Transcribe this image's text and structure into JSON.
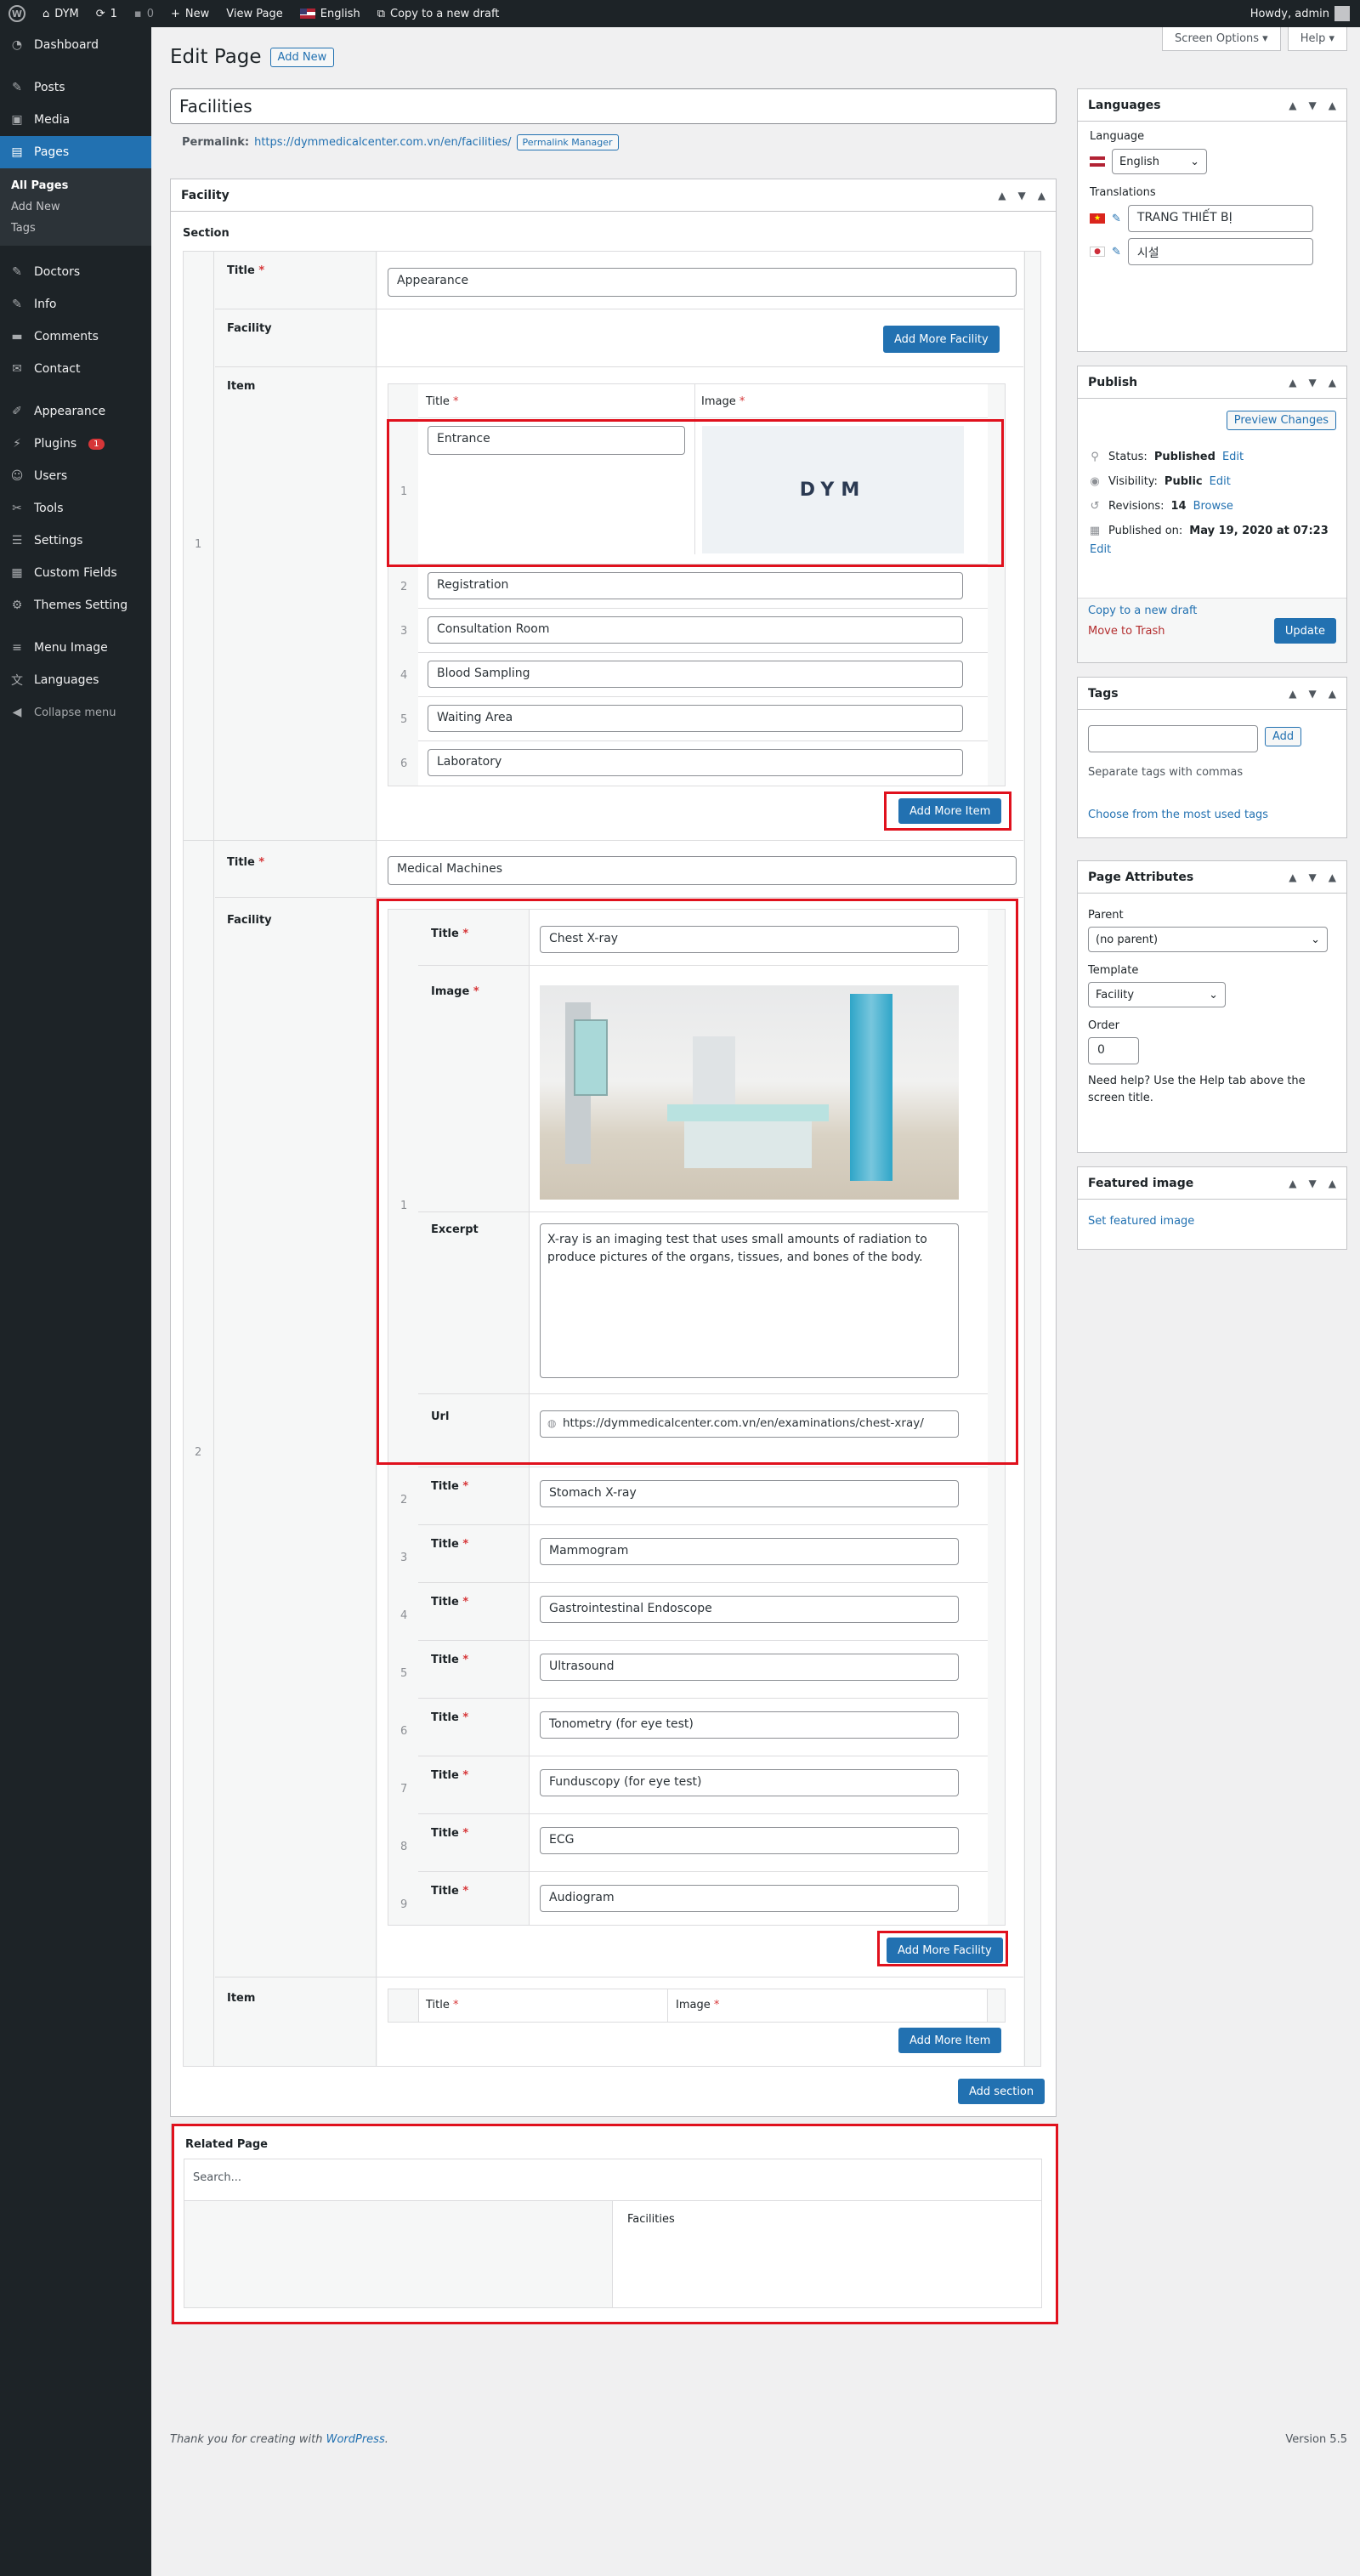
{
  "adminbar": {
    "site_name": "DYM",
    "updates_count": "1",
    "comments_count": "0",
    "new_label": "New",
    "view_page_label": "View Page",
    "language_label": "English",
    "copy_draft_label": "Copy to a new draft",
    "howdy": "Howdy, admin"
  },
  "sidebar": {
    "items": [
      {
        "label": "Dashboard",
        "icon": "dashboard-icon"
      },
      {
        "label": "Posts",
        "icon": "pin-icon"
      },
      {
        "label": "Media",
        "icon": "media-icon"
      },
      {
        "label": "Pages",
        "icon": "pages-icon"
      },
      {
        "label": "Doctors",
        "icon": "admin-post-icon"
      },
      {
        "label": "Info",
        "icon": "admin-post-icon"
      },
      {
        "label": "Comments",
        "icon": "comment-icon"
      },
      {
        "label": "Contact",
        "icon": "email-icon"
      },
      {
        "label": "Appearance",
        "icon": "brush-icon"
      },
      {
        "label": "Plugins",
        "icon": "plugin-icon",
        "badge": "1"
      },
      {
        "label": "Users",
        "icon": "users-icon"
      },
      {
        "label": "Tools",
        "icon": "wrench-icon"
      },
      {
        "label": "Settings",
        "icon": "settings-icon"
      },
      {
        "label": "Custom Fields",
        "icon": "grid-icon"
      },
      {
        "label": "Themes Setting",
        "icon": "gear-icon"
      },
      {
        "label": "Menu Image",
        "icon": "menu-icon"
      },
      {
        "label": "Languages",
        "icon": "translation-icon"
      }
    ],
    "submenu": [
      "All Pages",
      "Add New",
      "Tags"
    ],
    "collapse_label": "Collapse menu"
  },
  "screen_options": "Screen Options ▾",
  "help": "Help ▾",
  "page": {
    "heading": "Edit Page",
    "add_new": "Add New",
    "title_value": "Facilities",
    "permalink_label": "Permalink:",
    "permalink_url": "https://dymmedicalcenter.com.vn/en/facilities/",
    "permalink_manager": "Permalink Manager"
  },
  "facility": {
    "box_title": "Facility",
    "section_label": "Section",
    "title_label": "Title",
    "facility_label": "Facility",
    "item_label": "Item",
    "image_label": "Image",
    "excerpt_label": "Excerpt",
    "url_label": "Url",
    "add_more_facility": "Add More Facility",
    "add_more_item": "Add More Item",
    "add_section": "Add section",
    "section1": {
      "index": "1",
      "title": "Appearance",
      "items": [
        {
          "n": "1",
          "title": "Entrance",
          "image_text": "DYM"
        },
        {
          "n": "2",
          "title": "Registration"
        },
        {
          "n": "3",
          "title": "Consultation Room"
        },
        {
          "n": "4",
          "title": "Blood Sampling"
        },
        {
          "n": "5",
          "title": "Waiting Area"
        },
        {
          "n": "6",
          "title": "Laboratory"
        }
      ]
    },
    "section2": {
      "index": "2",
      "title": "Medical Machines",
      "first": {
        "n": "1",
        "title": "Chest X-ray",
        "excerpt": "X-ray is an imaging test that uses small amounts of radiation to produce pictures of the organs, tissues, and bones of the body.",
        "url": "https://dymmedicalcenter.com.vn/en/examinations/chest-xray/"
      },
      "facilities": [
        {
          "n": "2",
          "title": "Stomach X-ray"
        },
        {
          "n": "3",
          "title": "Mammogram"
        },
        {
          "n": "4",
          "title": "Gastrointestinal Endoscope"
        },
        {
          "n": "5",
          "title": "Ultrasound"
        },
        {
          "n": "6",
          "title": "Tonometry (for eye test)"
        },
        {
          "n": "7",
          "title": "Funduscopy (for eye test)"
        },
        {
          "n": "8",
          "title": "ECG"
        },
        {
          "n": "9",
          "title": "Audiogram"
        }
      ]
    }
  },
  "related": {
    "title": "Related Page",
    "search_placeholder": "Search...",
    "selected": "Facilities"
  },
  "languages_box": {
    "title": "Languages",
    "language_label": "Language",
    "language_value": "English",
    "translations_label": "Translations",
    "vi_value": "TRANG THIẾT BỊ",
    "ko_value": "시설"
  },
  "publish": {
    "title": "Publish",
    "preview": "Preview Changes",
    "status_label": "Status:",
    "status_value": "Published",
    "visibility_label": "Visibility:",
    "visibility_value": "Public",
    "revisions_label": "Revisions:",
    "revisions_value": "14",
    "browse": "Browse",
    "published_on_label": "Published on:",
    "published_on_value": "May 19, 2020 at 07:23",
    "edit": "Edit",
    "copy_draft": "Copy to a new draft",
    "trash": "Move to Trash",
    "update": "Update"
  },
  "tags": {
    "title": "Tags",
    "add": "Add",
    "hint": "Separate tags with commas",
    "choose": "Choose from the most used tags"
  },
  "attributes": {
    "title": "Page Attributes",
    "parent_label": "Parent",
    "parent_value": "(no parent)",
    "template_label": "Template",
    "template_value": "Facility",
    "order_label": "Order",
    "order_value": "0",
    "help": "Need help? Use the Help tab above the screen title."
  },
  "featured": {
    "title": "Featured image",
    "set": "Set featured image"
  },
  "footer": {
    "thanks": "Thank you for creating with",
    "wp_link": "WordPress",
    "version": "Version 5.5"
  }
}
